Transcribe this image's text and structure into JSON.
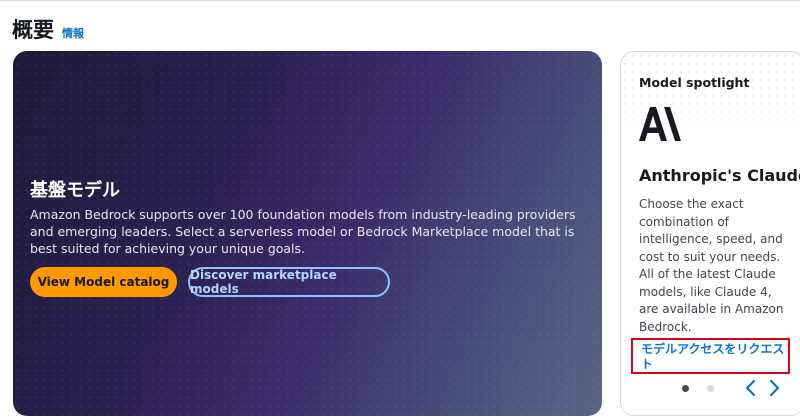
{
  "header": {
    "title": "概要",
    "info_link": "情報"
  },
  "hero": {
    "title": "基盤モデル",
    "description": "Amazon Bedrock supports over 100 foundation models from industry-leading providers and emerging leaders. Select a serverless model or Bedrock Marketplace model that is best suited for achieving your unique goals.",
    "primary_button": "View Model catalog",
    "secondary_button": "Discover marketplace models"
  },
  "spotlight": {
    "heading": "Model spotlight",
    "logo_icon": "anthropic-logo-icon",
    "title": "Anthropic's Claude",
    "description": "Choose the exact combination of intelligence, speed, and cost to suit your needs. All of the latest Claude models, like Claude 4, are available in Amazon Bedrock.",
    "access_link": "モデルアクセスをリクエスト",
    "pagination": {
      "pages": 2,
      "current": 1
    },
    "prev_icon": "chevron-left-icon",
    "next_icon": "chevron-right-icon"
  },
  "colors": {
    "accent": "#ff9900",
    "link": "#0972d3",
    "highlight": "#e3001b"
  }
}
